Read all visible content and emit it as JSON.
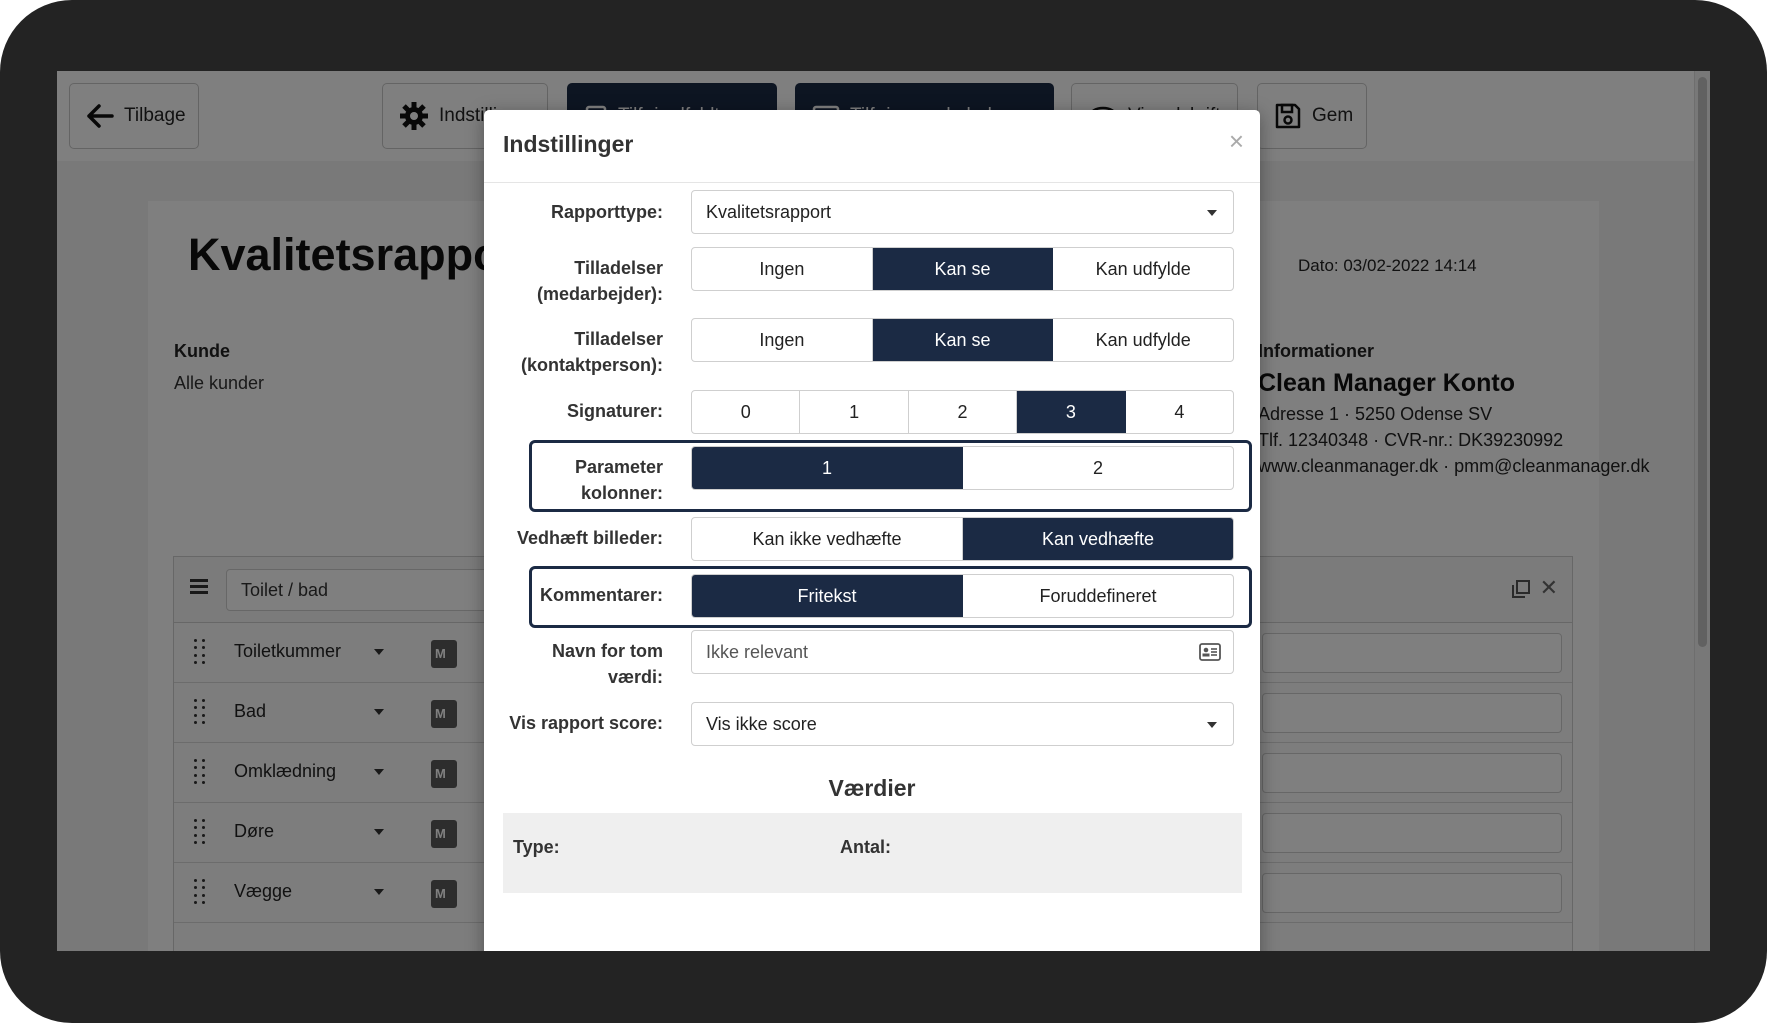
{
  "toolbar": {
    "back_label": "Tilbage",
    "settings_label": "Indstillinger",
    "add_filled_label": "Tilføj udfyldt",
    "add_template_label": "Tilføj som skabelon",
    "preview_label": "Vis udskrift",
    "save_label": "Gem"
  },
  "document": {
    "title": "Kvalitetsrapport",
    "date": "Dato: 03/02-2022 14:14",
    "customer_label": "Kunde",
    "customer_value": "Alle kunder",
    "info_label": "Informationer",
    "info_name": "Clean Manager Konto",
    "info_lines": [
      "Adresse 1 · 5250 Odense SV",
      "Tlf. 12340348 · CVR-nr.: DK39230992",
      "www.cleanmanager.dk · pmm@cleanmanager.dk"
    ]
  },
  "section": {
    "name": "Toilet / bad",
    "rows": [
      {
        "label": "Toiletkummer",
        "badge": "M"
      },
      {
        "label": "Bad",
        "badge": "M"
      },
      {
        "label": "Omklædning",
        "badge": "M"
      },
      {
        "label": "Døre",
        "badge": "M"
      },
      {
        "label": "Vægge",
        "badge": "M"
      }
    ]
  },
  "modal": {
    "title": "Indstillinger",
    "close_symbol": "×",
    "report_type": {
      "label": "Rapporttype:",
      "value": "Kvalitetsrapport"
    },
    "perm_employee": {
      "label": "Tilladelser (medarbejder):",
      "options": [
        "Ingen",
        "Kan se",
        "Kan udfylde"
      ],
      "selected": 1
    },
    "perm_contact": {
      "label": "Tilladelser (kontaktperson):",
      "options": [
        "Ingen",
        "Kan se",
        "Kan udfylde"
      ],
      "selected": 1
    },
    "signatures": {
      "label": "Signaturer:",
      "options": [
        "0",
        "1",
        "2",
        "3",
        "4"
      ],
      "selected": 3
    },
    "param_columns": {
      "label": "Parameter kolonner:",
      "options": [
        "1",
        "2"
      ],
      "selected": 0
    },
    "attach_images": {
      "label": "Vedhæft billeder:",
      "options": [
        "Kan ikke vedhæfte",
        "Kan vedhæfte"
      ],
      "selected": 1
    },
    "comments": {
      "label": "Kommentarer:",
      "options": [
        "Fritekst",
        "Foruddefineret"
      ],
      "selected": 0
    },
    "empty_value_name": {
      "label": "Navn for tom værdi:",
      "placeholder": "Ikke relevant"
    },
    "show_score": {
      "label": "Vis rapport score:",
      "value": "Vis ikke score"
    },
    "values_heading": "Værdier",
    "values_table": {
      "col_type": "Type:",
      "col_count": "Antal:"
    }
  },
  "colors": {
    "accent": "#1b2a44",
    "overlay": "rgba(0,0,0,0.5)",
    "frame": "#232323"
  }
}
